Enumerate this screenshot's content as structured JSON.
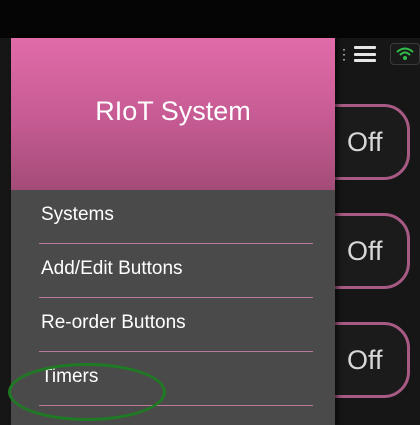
{
  "drawer": {
    "title": "RIoT System",
    "items": [
      {
        "label": "Systems"
      },
      {
        "label": "Add/Edit Buttons"
      },
      {
        "label": "Re-order Buttons"
      },
      {
        "label": "Timers"
      }
    ]
  },
  "buttons": [
    {
      "label": "Off"
    },
    {
      "label": "Off"
    },
    {
      "label": "Off"
    }
  ],
  "icons": [
    "overflow-dots-icon",
    "menu-icon",
    "wifi-icon"
  ],
  "colors": {
    "header_accent": "#e06ca9",
    "drawer_bg": "#4a4a4a",
    "highlight_ring": "#1f7a24"
  }
}
